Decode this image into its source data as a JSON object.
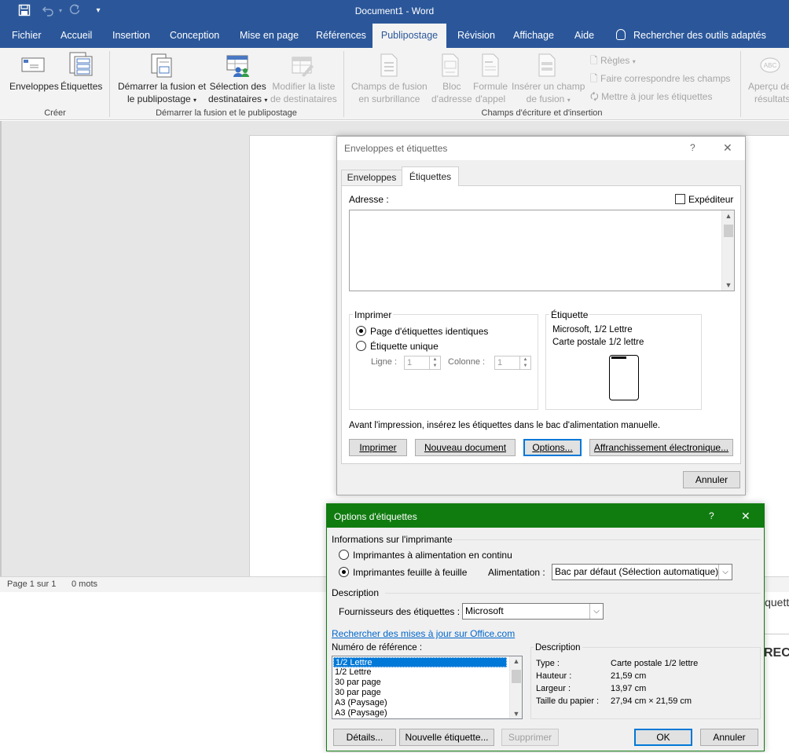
{
  "window": {
    "title": "Document1  -  Word"
  },
  "qat": {
    "save_icon": "save-icon",
    "undo_icon": "undo-icon",
    "redo_icon": "redo-icon",
    "customize_icon": "customize-qat-icon"
  },
  "tabs": [
    {
      "label": "Fichier"
    },
    {
      "label": "Accueil"
    },
    {
      "label": "Insertion"
    },
    {
      "label": "Conception"
    },
    {
      "label": "Mise en page"
    },
    {
      "label": "Références"
    },
    {
      "label": "Publipostage",
      "active": true
    },
    {
      "label": "Révision"
    },
    {
      "label": "Affichage"
    },
    {
      "label": "Aide"
    }
  ],
  "tellme": "Rechercher des outils adaptés",
  "ribbon": {
    "groups": {
      "create": "Créer",
      "start": "Démarrer la fusion et le publipostage",
      "fields": "Champs d'écriture et d'insertion"
    },
    "envelopes": "Enveloppes",
    "labels": "Étiquettes",
    "start_merge_1": "Démarrer la fusion et",
    "start_merge_2": "le publipostage",
    "select_recipients_1": "Sélection des",
    "select_recipients_2": "destinataires",
    "edit_list_1": "Modifier la liste",
    "edit_list_2": "de destinataires",
    "highlight_1": "Champs de fusion",
    "highlight_2": "en surbrillance",
    "address_block_1": "Bloc",
    "address_block_2": "d'adresse",
    "greeting_1": "Formule",
    "greeting_2": "d'appel",
    "insert_field_1": "Insérer un champ",
    "insert_field_2": "de fusion",
    "rules": "Règles",
    "match_fields": "Faire correspondre les champs",
    "update_labels": "Mettre à jour les étiquettes",
    "preview_1": "Aperçu de",
    "preview_2": "résultats",
    "preview_badge": "ABC"
  },
  "status": {
    "page": "Page 1 sur 1",
    "words": "0 mots"
  },
  "background_text": {
    "line1": "iquett",
    "line2": "RECT"
  },
  "dialog_env": {
    "title": "Enveloppes et étiquettes",
    "help": "?",
    "close": "✕",
    "tab_envelopes": "Enveloppes",
    "tab_labels": "Étiquettes",
    "address_label": "Adresse :",
    "sender_label": "Expéditeur",
    "print_group": "Imprimer",
    "radio_full_page": "Page d'étiquettes identiques",
    "radio_single": "Étiquette unique",
    "row_label": "Ligne :",
    "row_value": "1",
    "col_label": "Colonne :",
    "col_value": "1",
    "label_group": "Étiquette",
    "label_line1": "Microsoft, 1/2 Lettre",
    "label_line2": "Carte postale 1/2 lettre",
    "instruction": "Avant l'impression, insérez les étiquettes dans le bac d'alimentation manuelle.",
    "btn_print": "Imprimer",
    "btn_new_doc": "Nouveau document",
    "btn_options": "Options...",
    "btn_postage": "Affranchissement électronique...",
    "btn_cancel": "Annuler"
  },
  "dialog_opts": {
    "title": "Options d'étiquettes",
    "help": "?",
    "close": "✕",
    "printer_info": "Informations sur l'imprimante",
    "radio_continuous": "Imprimantes à alimentation en continu",
    "radio_page": "Imprimantes feuille à feuille",
    "tray_label": "Alimentation :",
    "tray_value": "Bac par défaut (Sélection automatique)",
    "description_section": "Description",
    "vendor_label": "Fournisseurs des étiquettes :",
    "vendor_value": "Microsoft",
    "update_link": "Rechercher des mises à jour sur Office.com",
    "product_number_label": "Numéro de référence :",
    "products": [
      "1/2 Lettre",
      "1/2 Lettre",
      "30 par page",
      "30 par page",
      "A3 (Paysage)",
      "A3 (Paysage)"
    ],
    "desc_group": "Description",
    "type_label": "Type :",
    "type_value": "Carte postale 1/2 lettre",
    "height_label": "Hauteur :",
    "height_value": "21,59 cm",
    "width_label": "Largeur :",
    "width_value": "13,97 cm",
    "paper_label": "Taille du papier :",
    "paper_value": "27,94 cm × 21,59 cm",
    "btn_details": "Détails...",
    "btn_new_label": "Nouvelle étiquette...",
    "btn_delete": "Supprimer",
    "btn_ok": "OK",
    "btn_cancel": "Annuler",
    "accent": "#107c10"
  },
  "colors": {
    "word_blue": "#2b579a",
    "ribbon_bg": "#f3f3f3",
    "dialog_bg": "#f0f0f0",
    "link": "#0066cc"
  }
}
